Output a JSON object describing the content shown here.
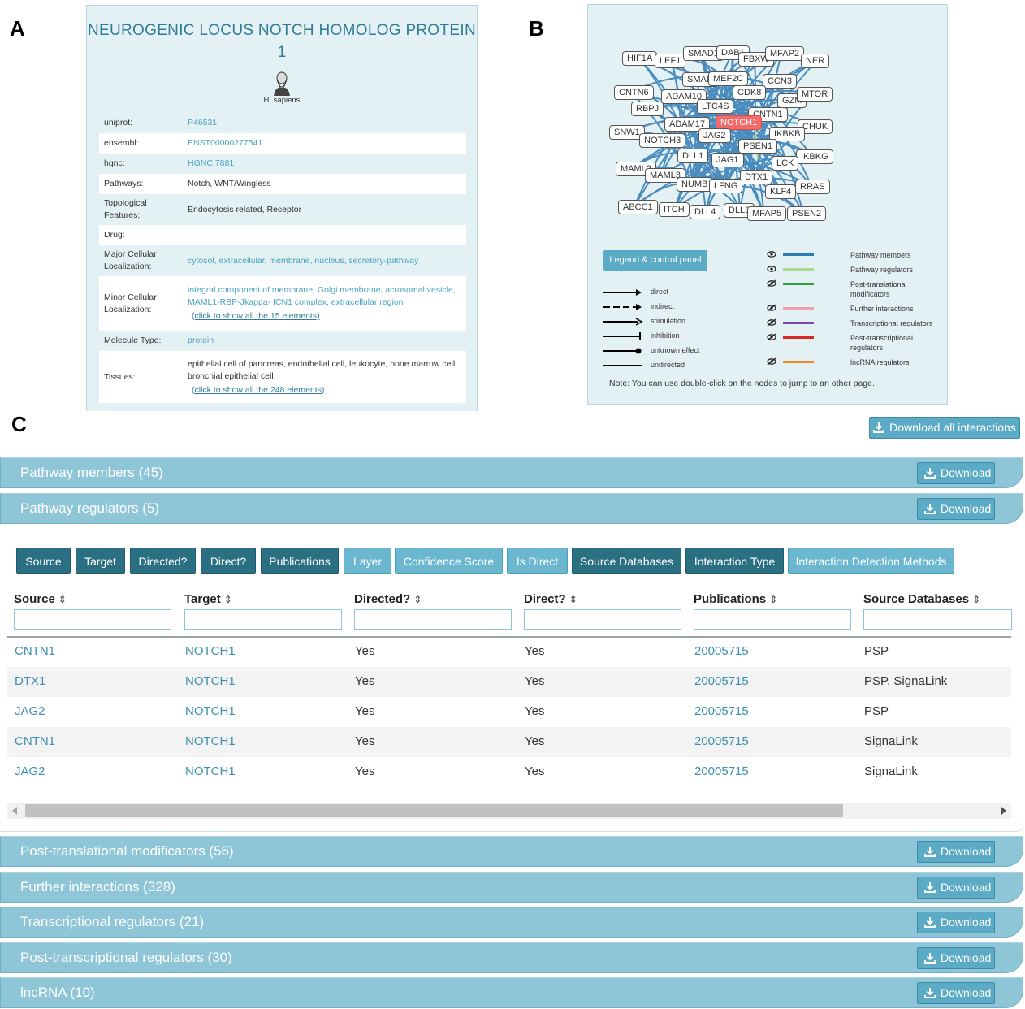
{
  "panel_labels": {
    "a": "A",
    "b": "B",
    "c": "C"
  },
  "protein": {
    "title": "NEUROGENIC LOCUS NOTCH HOMOLOG PROTEIN 1",
    "species": "H. sapiens",
    "species_icon": "darwin-portrait-icon",
    "fields": [
      {
        "label": "uniprot:",
        "value": "P46531",
        "link": true
      },
      {
        "label": "ensembl:",
        "value": "ENST00000277541",
        "link": true
      },
      {
        "label": "hgnc:",
        "value": "HGNC:7881",
        "link": true
      },
      {
        "label": "Pathways:",
        "value": "Notch, WNT/Wingless",
        "link": false
      },
      {
        "label": "Topological Features:",
        "value": "Endocytosis related, Receptor",
        "link": false
      },
      {
        "label": "Drug:",
        "value": "",
        "link": false
      },
      {
        "label": "Major Cellular Localization:",
        "value": "cytosol, extracellular, membrane, nucleus, secretory-pathway",
        "link": true
      },
      {
        "label": "Minor Cellular Localization:",
        "value": "integral component of membrane, Golgi membrane, acrosomal vesicle, MAML1-RBP-Jkappa- ICN1 complex, extracellular region",
        "link": true,
        "more": "(click to show all the 15 elements)"
      },
      {
        "label": "Molecule Type:",
        "value": "protein",
        "link": true
      },
      {
        "label": "Tissues:",
        "value": "epithelial cell of pancreas, endothelial cell, leukocyte, bone marrow cell, bronchial epithelial cell",
        "link": false,
        "more": "(click to show all the 248 elements)"
      }
    ]
  },
  "network": {
    "nodes": [
      "HIF1A",
      "LEF1",
      "SMAD1",
      "DAB1",
      "FBXW",
      "MFAP2",
      "NER",
      "SMAD",
      "MEF2C",
      "CCN3",
      "CNTN6",
      "ADAM10",
      "CDK8",
      "GZM",
      "MTOR",
      "RBPJ",
      "LTC4S",
      "CNTN1",
      "ADAM17",
      "NOTCH1",
      "CHUK",
      "SNW1",
      "JAG2",
      "IKBKB",
      "NOTCH3",
      "PSEN1",
      "DLL1",
      "JAG1",
      "IKBKG",
      "LCK",
      "MAML2",
      "MAML3",
      "DTX1",
      "NUMB",
      "LFNG",
      "KLF4",
      "RRAS",
      "ABCC1",
      "ITCH",
      "DLL4",
      "DLL3",
      "MFAP5",
      "PSEN2"
    ],
    "highlight": "NOTCH1",
    "legend_button": "Legend & control panel",
    "edge_types": [
      "direct",
      "indirect",
      "stimulation",
      "inhibition",
      "unknown effect",
      "undirected"
    ],
    "layers": [
      {
        "name": "Pathway members",
        "color": "#2e7bb4",
        "visible": true
      },
      {
        "name": "Pathway regulators",
        "color": "#a7d98e",
        "visible": true
      },
      {
        "name": "Post-translational modificators",
        "color": "#2f9e3c",
        "visible": false
      },
      {
        "name": "Further interactions",
        "color": "#f2a0a8",
        "visible": false
      },
      {
        "name": "Transcriptional regulators",
        "color": "#7a4aa8",
        "visible": false
      },
      {
        "name": "Post-transcriptional regulators",
        "color": "#d42a2a",
        "visible": false
      },
      {
        "name": "lncRNA regulators",
        "color": "#f08a26",
        "visible": false
      }
    ],
    "note": "Note: You can use double-click on the nodes to jump to an other page."
  },
  "interactions": {
    "download_all": "Download all interactions",
    "download_label": "Download",
    "sections_top": [
      {
        "title": "Pathway members (45)"
      },
      {
        "title": "Pathway regulators (5)"
      }
    ],
    "column_toggles": [
      {
        "label": "Source",
        "on": true
      },
      {
        "label": "Target",
        "on": true
      },
      {
        "label": "Directed?",
        "on": true
      },
      {
        "label": "Direct?",
        "on": true
      },
      {
        "label": "Publications",
        "on": true
      },
      {
        "label": "Layer",
        "on": false
      },
      {
        "label": "Confidence Score",
        "on": false
      },
      {
        "label": "Is Direct",
        "on": false
      },
      {
        "label": "Source Databases",
        "on": true
      },
      {
        "label": "Interaction Type",
        "on": true
      },
      {
        "label": "Interaction Detection Methods",
        "on": false
      }
    ],
    "headers": [
      "Source",
      "Target",
      "Directed?",
      "Direct?",
      "Publications",
      "Source Databases"
    ],
    "sort_glyph": "⇕",
    "rows": [
      [
        "CNTN1",
        "NOTCH1",
        "Yes",
        "Yes",
        "20005715",
        "PSP"
      ],
      [
        "DTX1",
        "NOTCH1",
        "Yes",
        "Yes",
        "20005715",
        "PSP, SignaLink"
      ],
      [
        "JAG2",
        "NOTCH1",
        "Yes",
        "Yes",
        "20005715",
        "PSP"
      ],
      [
        "CNTN1",
        "NOTCH1",
        "Yes",
        "Yes",
        "20005715",
        "SignaLink"
      ],
      [
        "JAG2",
        "NOTCH1",
        "Yes",
        "Yes",
        "20005715",
        "SignaLink"
      ]
    ],
    "sections_bottom": [
      {
        "title": "Post-translational modificators (56)"
      },
      {
        "title": "Further interactions (328)"
      },
      {
        "title": "Transcriptional regulators (21)"
      },
      {
        "title": "Post-transcriptional regulators (30)"
      },
      {
        "title": "lncRNA (10)"
      }
    ]
  }
}
